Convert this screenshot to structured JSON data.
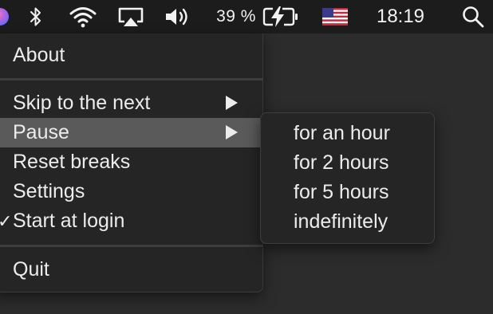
{
  "menubar": {
    "app_icon": "app-status-icon",
    "bluetooth_icon": "bluetooth-icon",
    "wifi_icon": "wifi-icon",
    "airplay_icon": "airplay-icon",
    "volume_icon": "volume-icon",
    "battery_percent": "39 %",
    "battery_icon": "battery-charging-icon",
    "input_source_icon": "us-flag-icon",
    "clock": "18:19",
    "spotlight_icon": "search-icon"
  },
  "menu": {
    "items": [
      {
        "label": "About",
        "has_submenu": false,
        "checked": false,
        "highlighted": false
      },
      {
        "label": "Skip to the next",
        "has_submenu": true,
        "checked": false,
        "highlighted": false
      },
      {
        "label": "Pause",
        "has_submenu": true,
        "checked": false,
        "highlighted": true
      },
      {
        "label": "Reset breaks",
        "has_submenu": false,
        "checked": false,
        "highlighted": false
      },
      {
        "label": "Settings",
        "has_submenu": false,
        "checked": false,
        "highlighted": false
      },
      {
        "label": "Start at login",
        "has_submenu": false,
        "checked": true,
        "highlighted": false
      },
      {
        "label": "Quit",
        "has_submenu": false,
        "checked": false,
        "highlighted": false
      }
    ],
    "check_glyph": "✓"
  },
  "pause_submenu": {
    "items": [
      {
        "label": "for an hour"
      },
      {
        "label": "for 2 hours"
      },
      {
        "label": "for 5 hours"
      },
      {
        "label": "indefinitely"
      }
    ]
  },
  "colors": {
    "menubar_bg": "#1c1c1c",
    "menu_bg": "#252525",
    "highlight_bg": "#5a5a5a",
    "text": "#ececec"
  }
}
